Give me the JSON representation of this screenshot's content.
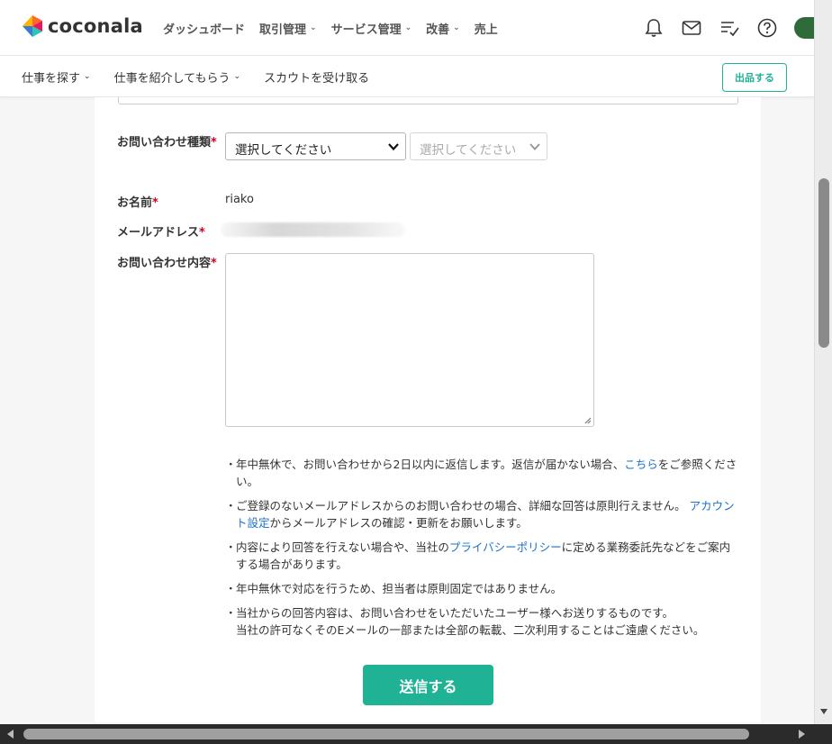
{
  "brand": {
    "name": "coconala"
  },
  "nav": [
    {
      "label": "ダッシュボード",
      "dropdown": false
    },
    {
      "label": "取引管理",
      "dropdown": true
    },
    {
      "label": "サービス管理",
      "dropdown": true
    },
    {
      "label": "改善",
      "dropdown": true
    },
    {
      "label": "売上",
      "dropdown": false
    }
  ],
  "subnav": {
    "find_job": "仕事を探す",
    "introduce_job": "仕事を紹介してもらう",
    "scout": "スカウトを受け取る",
    "post_button": "出品する"
  },
  "form": {
    "category_label": "お問い合わせ種類",
    "category_select_1": "選択してください",
    "category_select_2": "選択してください",
    "name_label": "お名前",
    "name_value": "riako",
    "email_label": "メールアドレス",
    "content_label": "お問い合わせ内容",
    "required_mark": "*",
    "submit_label": "送信する"
  },
  "notes": {
    "bullet": "・",
    "n1_pre": "年中無休で、お問い合わせから2日以内に返信します。返信が届かない場合、",
    "n1_link": "こちら",
    "n1_post": "をご参照ください。",
    "n2_pre": "ご登録のないメールアドレスからのお問い合わせの場合、詳細な回答は原則行えません。",
    "n2_link": "アカウント設定",
    "n2_post": "からメールアドレスの確認・更新をお願いします。",
    "n3_pre": "内容により回答を行えない場合や、当社の",
    "n3_link": "プライバシーポリシー",
    "n3_post": "に定める業務委託先などをご案内する場合があります。",
    "n4": "年中無休で対応を行うため、担当者は原則固定ではありません。",
    "n5_line1": "当社からの回答内容は、お問い合わせをいただいたユーザー様へお送りするものです。",
    "n5_line2": "当社の許可なくそのEメールの一部または全部の転載、二次利用することはご遠慮ください。"
  },
  "colors": {
    "accent": "#1fb295",
    "link": "#1a73c8",
    "required": "#d0021b"
  },
  "icons": [
    "bell-icon",
    "mail-icon",
    "tasklist-icon",
    "help-icon",
    "chevron-down-icon",
    "resize-grip-icon"
  ]
}
